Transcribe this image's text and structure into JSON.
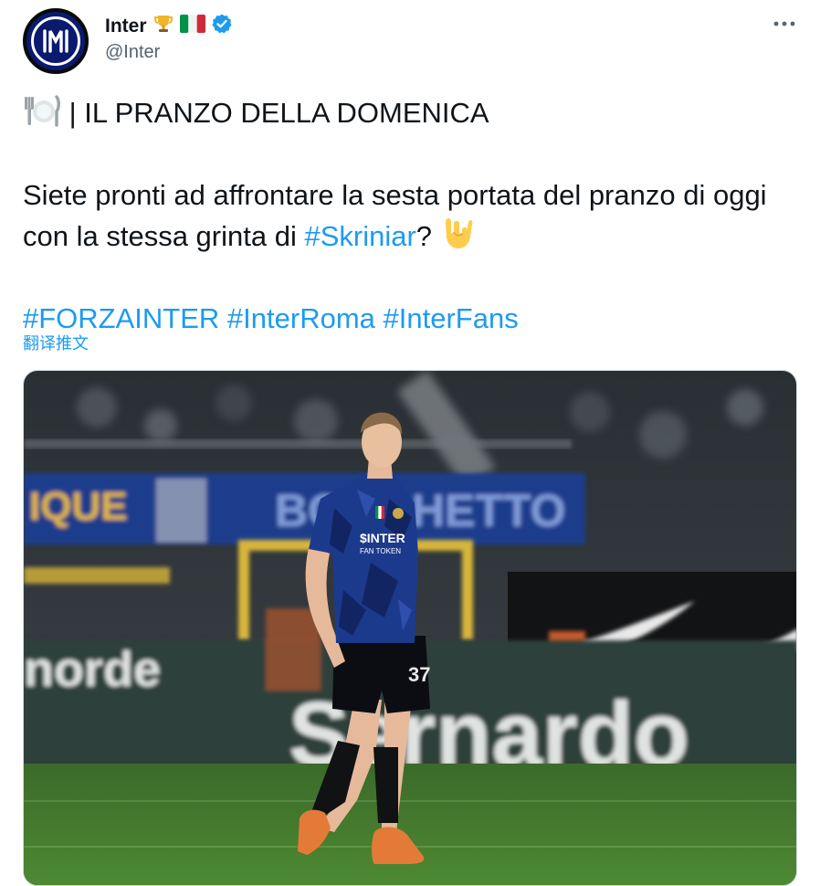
{
  "author": {
    "display_name": "Inter",
    "handle": "@Inter",
    "avatar_icon": "inter-logo-icon",
    "badges": [
      "trophy-icon",
      "italy-flag-icon",
      "verified-badge-icon"
    ]
  },
  "tweet": {
    "line1": " | IL PRANZO DELLA DOMENICA",
    "line2_before": "Siete pronti ad affrontare la sesta portata del pranzo di oggi con la stessa grinta di ",
    "line2_hashtag": "#Skriniar",
    "line2_after": "? ",
    "hashtags": [
      "#FORZAINTER",
      "#InterRoma",
      "#InterFans"
    ],
    "emoji_plate": "plate-cutlery-icon",
    "emoji_hand": "love-you-gesture-icon"
  },
  "translate_label": "翻译推文",
  "media": {
    "description_icon": "photo",
    "banner_left": "IQUE",
    "banner_right": "BORGHETTO",
    "board_text": "Sernardo",
    "board_text_left": "norde",
    "shirt_sponsor": "$INTER",
    "shirt_sponsor_sub": "FAN TOKEN",
    "shorts_number": "37"
  },
  "colors": {
    "link": "#1d9bf0",
    "text": "#0f1419",
    "secondary": "#536471",
    "inter_blue": "#0a1a6e",
    "verified": "#1d9bf0"
  }
}
